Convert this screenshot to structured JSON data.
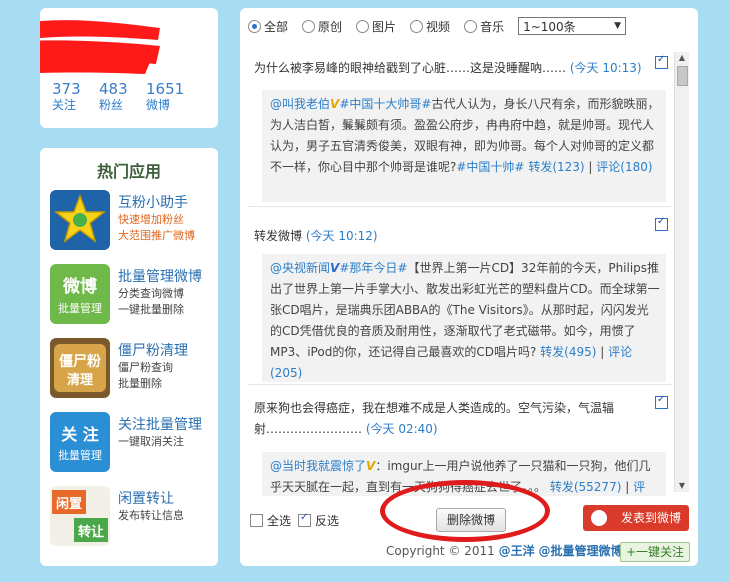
{
  "profile": {
    "stats": [
      {
        "num": "373",
        "label": "关注"
      },
      {
        "num": "483",
        "label": "粉丝"
      },
      {
        "num": "1651",
        "label": "微博"
      }
    ]
  },
  "apps": {
    "title": "热门应用",
    "items": [
      {
        "name": "互粉小助手",
        "d1": "快速增加粉丝",
        "d2": "大范围推广微博",
        "icon": "helper-star-icon"
      },
      {
        "name": "批量管理微博",
        "d1": "分类查询微博",
        "d2": "一键批量删除",
        "icon": "batch-weibo-icon",
        "icon_text1": "微博",
        "icon_text2": "批量管理"
      },
      {
        "name": "僵尸粉清理",
        "d1": "僵尸粉查询",
        "d2": "批量删除",
        "icon": "zombie-fans-icon",
        "icon_text1": "僵尸粉",
        "icon_text2": "清理"
      },
      {
        "name": "关注批量管理",
        "d1": "一键取消关注",
        "d2": "",
        "icon": "follow-batch-icon",
        "icon_text1": "关 注",
        "icon_text2": "批量管理"
      },
      {
        "name": "闲置转让",
        "d1": "发布转让信息",
        "d2": "",
        "icon": "idle-transfer-icon",
        "icon_text1": "闲置",
        "icon_text2": "转让"
      }
    ]
  },
  "filters": {
    "options": [
      {
        "label": "全部",
        "selected": true
      },
      {
        "label": "原创",
        "selected": false
      },
      {
        "label": "图片",
        "selected": false
      },
      {
        "label": "视频",
        "selected": false
      },
      {
        "label": "音乐",
        "selected": false
      }
    ],
    "range": "1~100条"
  },
  "posts": [
    {
      "text": "为什么被李易峰的眼神给戳到了心脏……这是没睡醒吶……",
      "time": "(今天 10:13)",
      "quote_user": "@叫我老伯",
      "badge": "V",
      "quote_tag": "#中国十大帅哥#",
      "quote_text": "古代人认为，身长八尺有余，而形貌昳丽，为人洁白皙，鬑鬑颇有须。盈盈公府步，冉冉府中趋，就是帅哥。现代人认为，男子五官清秀俊美，双眼有神，即为帅哥。每个人对帅哥的定义都不一样，你心目中那个帅哥是谁呢?",
      "quote_tag2": "#中国十帅#",
      "forward": "转发(123)",
      "comment": "评论(180)"
    },
    {
      "text": "转发微博",
      "time": "(今天 10:12)",
      "quote_user": "@央视新闻",
      "badge": "V",
      "quote_tag": "#那年今日#",
      "quote_text": "【世界上第一片CD】32年前的今天，Philips推出了世界上第一片手掌大小、散发出彩虹光芒的塑料盘片CD。而全球第一张CD唱片，是瑞典乐团ABBA的《The Visitors》。从那时起，闪闪发光的CD凭借优良的音质及耐用性，逐渐取代了老式磁带。如今，用惯了MP3、iPod的你，还记得自己最喜欢的CD唱片吗?",
      "quote_tag2": "",
      "forward": "转发(495)",
      "comment": "评论(205)"
    },
    {
      "text": "原来狗也会得癌症，我在想难不成是人类造成的。空气污染，气温辐射……………………",
      "time": "(今天 02:40)",
      "quote_user": "@当时我就震惊了",
      "badge": "V",
      "quote_tag": "",
      "quote_text": "：imgur上一用户说他养了一只猫和一只狗，他们几乎天天腻在一起，直到有一天狗狗得癌症去世了。。。",
      "quote_tag2": "",
      "forward": "转发(55277)",
      "comment": "评"
    }
  ],
  "bottom": {
    "select_all": "全选",
    "invert": "反选",
    "delete": "删除微博",
    "send": "发表到微博"
  },
  "footer": {
    "copyright": "Copyright © 2011",
    "author": "@王洋",
    "app": "@批量管理微博",
    "follow": "+一键关注"
  },
  "colors": {
    "background": "#a8dcf2",
    "link": "#2b7ec9",
    "accent_red": "#e01b1b"
  }
}
